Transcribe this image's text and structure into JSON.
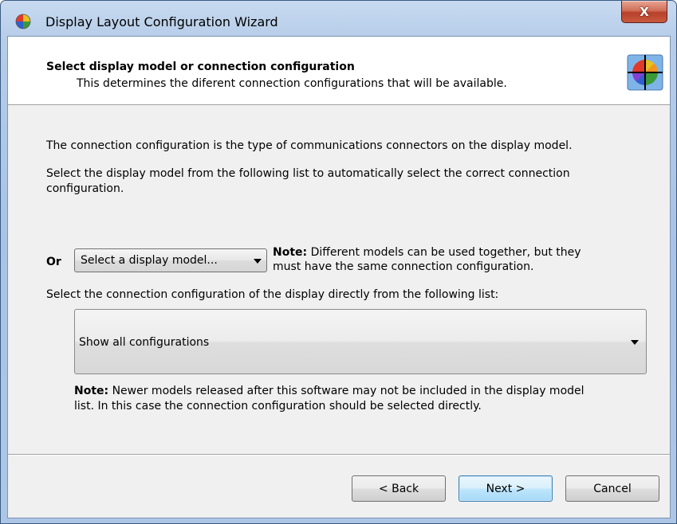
{
  "window": {
    "title": "Display Layout Configuration Wizard",
    "close_label": "X",
    "icon": "color-wheel-icon"
  },
  "header": {
    "title": "Select display model or connection configuration",
    "subtitle": "This determines the diferent connection configurations that will be available.",
    "icon": "color-wheel-crosshair-icon"
  },
  "body": {
    "intro": "The connection configuration is the type of communications connectors on the display model.",
    "select_model_line1": "Select the display model from the following list to automatically select the correct connection",
    "select_model_line2": "configuration.",
    "model_select": {
      "value": "Select a display model..."
    },
    "note1": {
      "label": "Note:",
      "line1": "Different models can be used together, but they",
      "line2": "must have the same connection configuration."
    },
    "or_label": "Or",
    "select_config_text": "Select the connection configuration of the display directly from the following list:",
    "config_select": {
      "value": "Show all configurations"
    },
    "note2": {
      "label": "Note:",
      "line1": "Newer models released after this software may not be included in the display model",
      "line2": "list. In this case the connection configuration should be selected directly."
    }
  },
  "footer": {
    "back_label": "< Back",
    "next_label": "Next >",
    "cancel_label": "Cancel"
  }
}
